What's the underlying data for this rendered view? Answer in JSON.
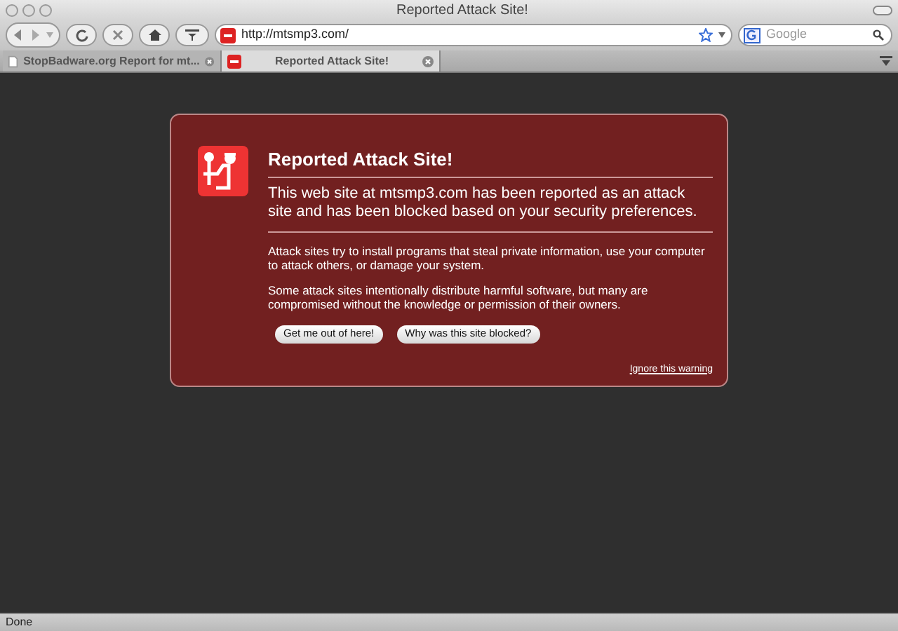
{
  "window": {
    "title": "Reported Attack Site!"
  },
  "toolbar": {
    "url": "http://mtsmp3.com/",
    "search": {
      "placeholder": "Google"
    }
  },
  "tabs": [
    {
      "label": "StopBadware.org Report for mt...",
      "selected": false,
      "kind": "page"
    },
    {
      "label": "Reported Attack Site!",
      "selected": true,
      "kind": "blocked"
    }
  ],
  "warning": {
    "title": "Reported Attack Site!",
    "summary": "This web site at mtsmp3.com has been reported as an attack site and has been blocked based on your security preferences.",
    "paragraphs": [
      "Attack sites try to install programs that steal private information, use your computer to attack others, or damage your system.",
      "Some attack sites intentionally distribute harmful software, but many are compromised without the knowledge or permission of their owners."
    ],
    "buttons": [
      "Get me out of here!",
      "Why was this site blocked?"
    ],
    "ignore_link": "Ignore this warning"
  },
  "status_bar": "Done"
}
